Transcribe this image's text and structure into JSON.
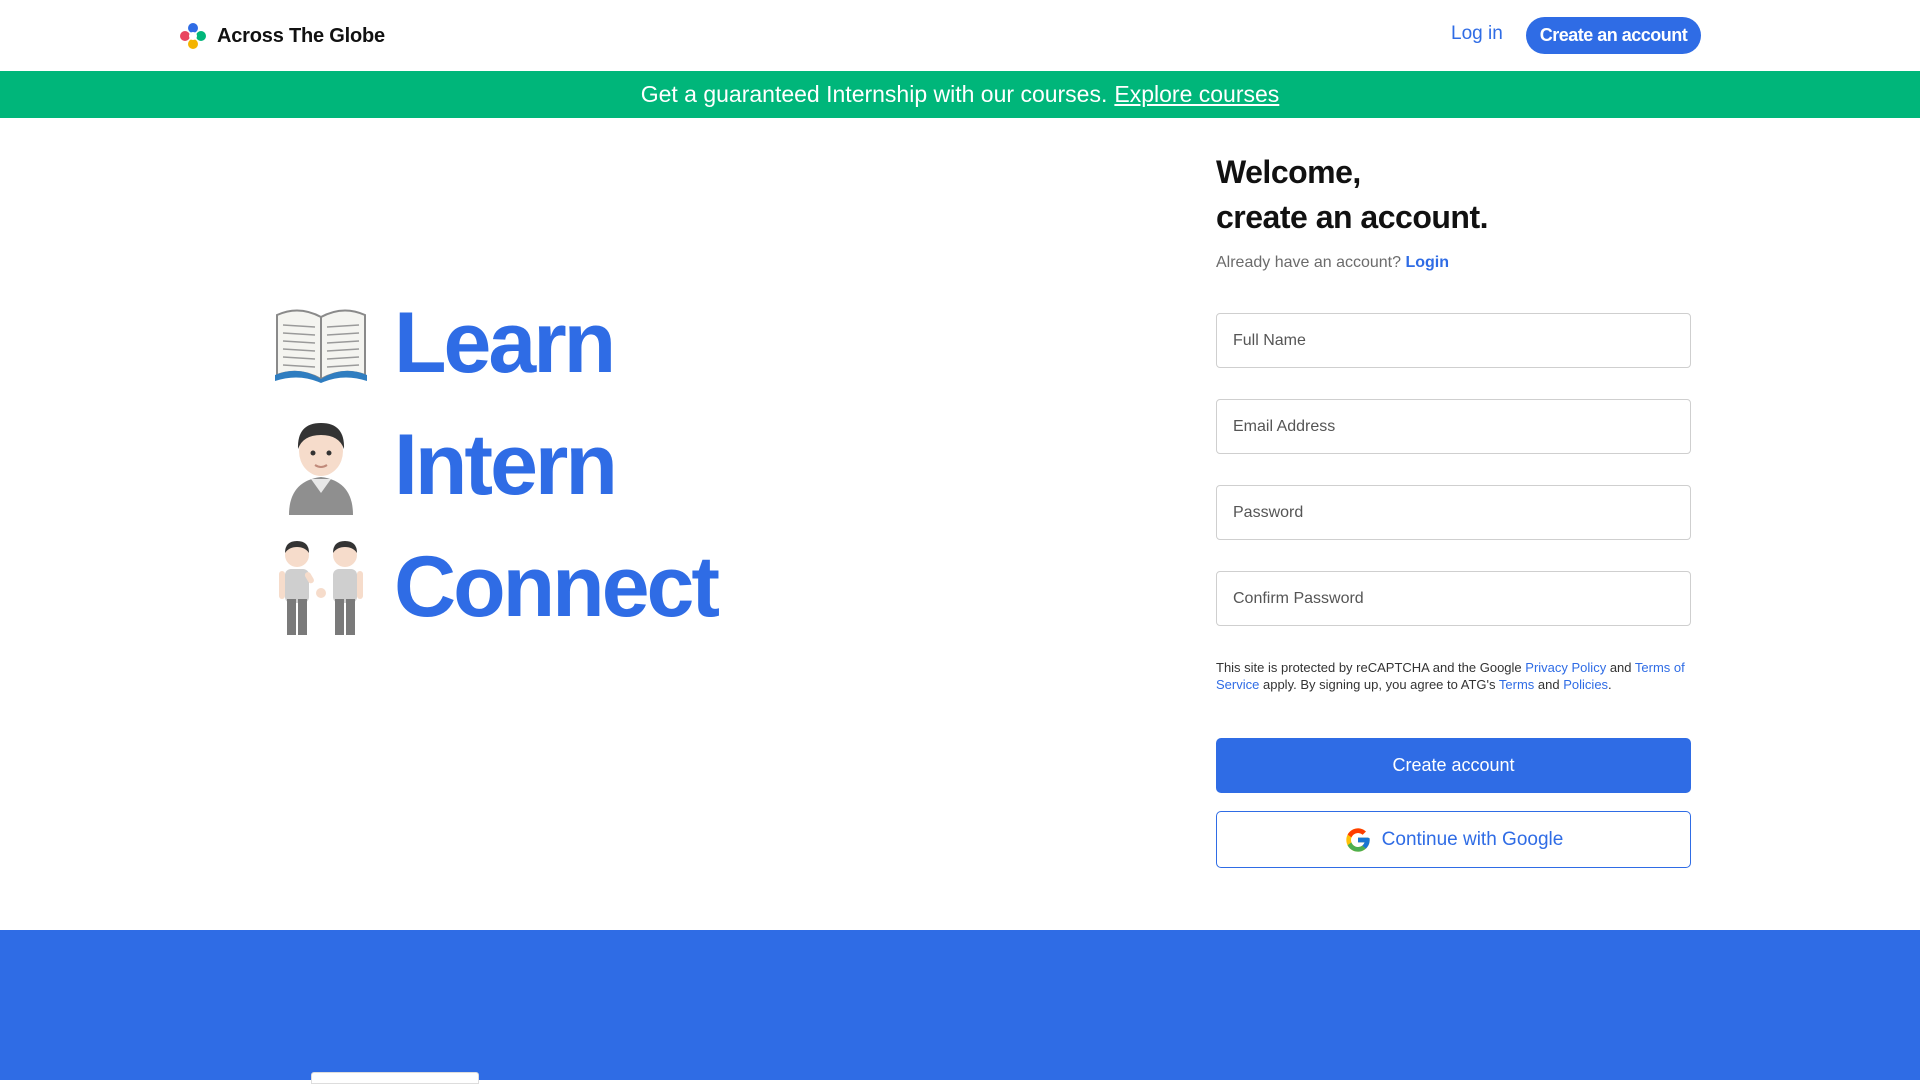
{
  "header": {
    "brand_name": "Across The Globe",
    "login_label": "Log in",
    "create_label": "Create an account"
  },
  "banner": {
    "text": "Get a guaranteed Internship with our courses.",
    "link": "Explore courses",
    "color": "#00b67a"
  },
  "hero": {
    "items": [
      {
        "icon": "open-book-icon",
        "word": "Learn"
      },
      {
        "icon": "person-icon",
        "word": "Intern"
      },
      {
        "icon": "people-holding-hands-icon",
        "word": "Connect"
      }
    ]
  },
  "form": {
    "title_line1": "Welcome,",
    "title_line2": "create an account.",
    "already_text": "Already have an account?",
    "login_link": "Login",
    "full_name_placeholder": "Full Name",
    "email_placeholder": "Email Address",
    "password_placeholder": "Password",
    "confirm_placeholder": "Confirm Password",
    "legal": {
      "part1": "This site is protected by reCAPTCHA and the Google",
      "privacy": "Privacy Policy",
      "and1": "and",
      "tos": "Terms of Service",
      "part2": "apply. By signing up, you agree to ATG's",
      "terms": "Terms",
      "and2": "and",
      "policies": "Policies",
      "period": "."
    },
    "create_button": "Create account",
    "google_button": "Continue with Google"
  },
  "colors": {
    "accent": "#2f6ce5",
    "banner": "#00b67a"
  }
}
